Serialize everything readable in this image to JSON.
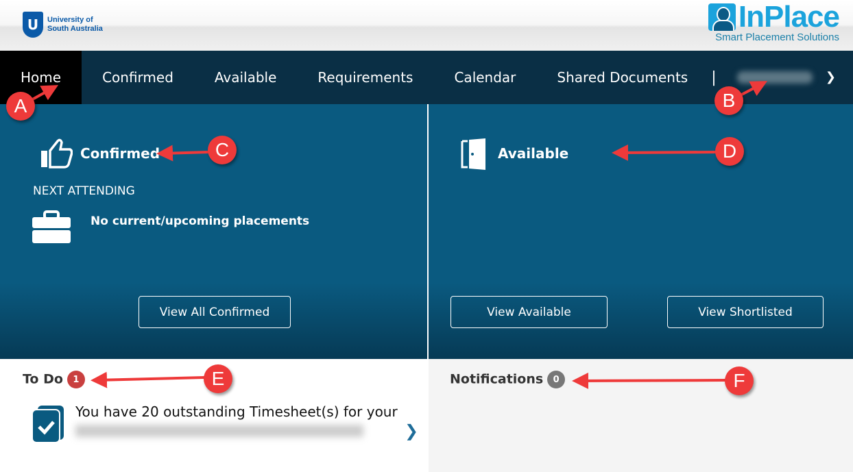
{
  "header": {
    "university": [
      "University of",
      "South Australia"
    ],
    "brand": "InPlace",
    "tagline": "Smart Placement Solutions"
  },
  "nav": {
    "items": [
      {
        "label": "Home",
        "active": true
      },
      {
        "label": "Confirmed"
      },
      {
        "label": "Available"
      },
      {
        "label": "Requirements"
      },
      {
        "label": "Calendar"
      },
      {
        "label": "Shared Documents"
      }
    ],
    "separator": "|",
    "dropdown_icon": "chevron-down-icon"
  },
  "confirmed": {
    "title": "Confirmed",
    "next_label": "NEXT ATTENDING",
    "empty": "No current/upcoming placements",
    "button": "View All Confirmed",
    "icon": "thumbs-up-icon"
  },
  "available": {
    "title": "Available",
    "button_available": "View Available",
    "button_shortlisted": "View Shortlisted",
    "icon": "door-open-icon"
  },
  "todo": {
    "title": "To Do",
    "count": "1",
    "item": "You have 20 outstanding Timesheet(s) for your",
    "badge_color": "#c9403f"
  },
  "notifications": {
    "title": "Notifications",
    "count": "0",
    "badge_color": "#777777"
  },
  "annotations": [
    "A",
    "B",
    "C",
    "D",
    "E",
    "F"
  ],
  "colors": {
    "nav": "#0a2f45",
    "panel": "#0a5a80",
    "annotation": "#ee3a3a",
    "brand": "#1ba3dc"
  }
}
